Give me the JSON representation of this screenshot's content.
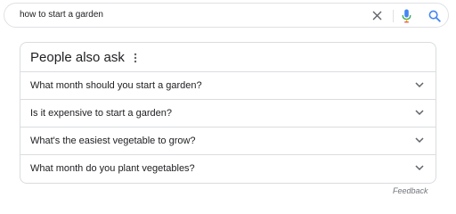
{
  "search": {
    "query": "how to start a garden"
  },
  "people_also_ask": {
    "title": "People also ask",
    "questions": [
      {
        "label": "What month should you start a garden?"
      },
      {
        "label": "Is it expensive to start a garden?"
      },
      {
        "label": "What's the easiest vegetable to grow?"
      },
      {
        "label": "What month do you plant vegetables?"
      }
    ]
  },
  "footer": {
    "feedback_label": "Feedback"
  },
  "icons": {
    "clear": "close-icon",
    "voice": "microphone-icon",
    "search": "search-icon",
    "more": "more-vert-icon",
    "expand": "chevron-down-icon"
  },
  "colors": {
    "text": "#202124",
    "border": "#dadce0",
    "muted": "#70757a",
    "search_blue": "#4285f4",
    "mic_red": "#ea4335"
  }
}
